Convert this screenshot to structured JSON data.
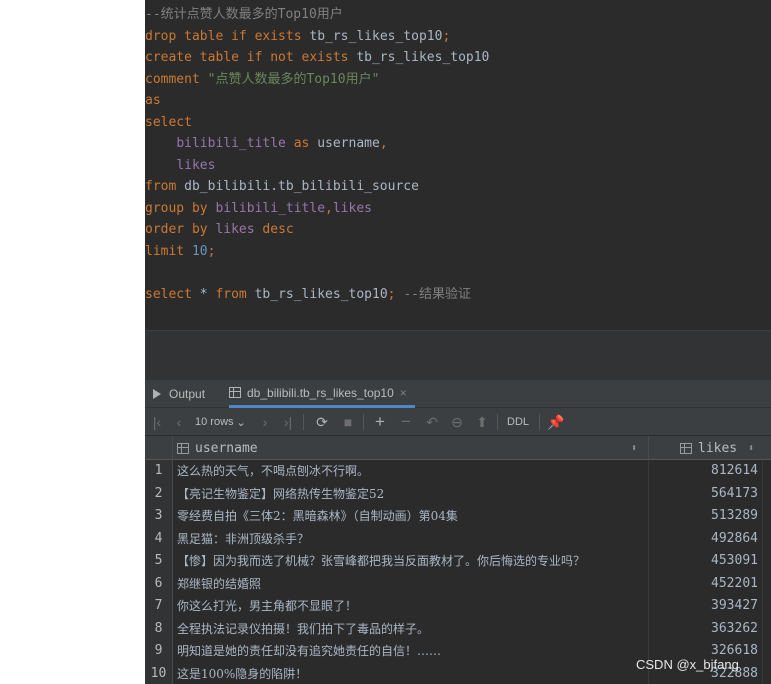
{
  "editor": {
    "lines": [
      [
        [
          "cmt",
          "--统计点赞人数最多的Top10用户"
        ]
      ],
      [
        [
          "kw",
          "drop table if exists "
        ],
        [
          "plain",
          "tb_rs_likes_top10"
        ],
        [
          "kw",
          ";"
        ]
      ],
      [
        [
          "kw",
          "create table if not exists "
        ],
        [
          "plain",
          "tb_rs_likes_top10"
        ]
      ],
      [
        [
          "kw",
          "comment "
        ],
        [
          "str",
          "\"点赞人数最多的Top10用户\""
        ]
      ],
      [
        [
          "kw",
          "as"
        ]
      ],
      [
        [
          "kw",
          "select"
        ]
      ],
      [
        [
          "plain",
          "    "
        ],
        [
          "fld",
          "bilibili_title"
        ],
        [
          "kw",
          " as "
        ],
        [
          "plain",
          "username"
        ],
        [
          "kw",
          ","
        ]
      ],
      [
        [
          "plain",
          "    "
        ],
        [
          "fld",
          "likes"
        ]
      ],
      [
        [
          "kw",
          "from "
        ],
        [
          "plain",
          "db_bilibili.tb_bilibili_source"
        ]
      ],
      [
        [
          "kw",
          "group by "
        ],
        [
          "fld",
          "bilibili_title"
        ],
        [
          "kw",
          ","
        ],
        [
          "fld",
          "likes"
        ]
      ],
      [
        [
          "kw",
          "order by "
        ],
        [
          "fld",
          "likes"
        ],
        [
          "kw",
          " desc"
        ]
      ],
      [
        [
          "kw",
          "limit "
        ],
        [
          "num",
          "10"
        ],
        [
          "kw",
          ";"
        ]
      ],
      [],
      [
        [
          "kw",
          "select "
        ],
        [
          "plain",
          "* "
        ],
        [
          "kw",
          "from "
        ],
        [
          "plain",
          "tb_rs_likes_top10"
        ],
        [
          "kw",
          "; "
        ],
        [
          "cmt",
          "--结果验证"
        ]
      ]
    ]
  },
  "tabs": {
    "output_label": "Output",
    "result_label": "db_bilibili.tb_rs_likes_top10",
    "close_glyph": "×"
  },
  "toolbar": {
    "rows_label": "10 rows",
    "rows_arrow": "⌄",
    "ddl_label": "DDL"
  },
  "table": {
    "columns": [
      "username",
      "likes"
    ],
    "sort_glyph": "⬍",
    "rows": [
      {
        "n": "1",
        "username": "这么热的天气，不喝点刨冰不行啊。",
        "likes": "812614"
      },
      {
        "n": "2",
        "username": "【亮记生物鉴定】网络热传生物鉴定52",
        "likes": "564173"
      },
      {
        "n": "3",
        "username": "零经费自拍《三体2：黑暗森林》（自制动画）第04集",
        "likes": "513289"
      },
      {
        "n": "4",
        "username": "黑足猫：非洲顶级杀手？",
        "likes": "492864"
      },
      {
        "n": "5",
        "username": "【惨】因为我而选了机械？张雪峰都把我当反面教材了。你后悔选的专业吗？",
        "likes": "453091"
      },
      {
        "n": "6",
        "username": "郑继银的结婚照",
        "likes": "452201"
      },
      {
        "n": "7",
        "username": "你这么打光，男主角都不显眼了！",
        "likes": "393427"
      },
      {
        "n": "8",
        "username": "全程执法记录仪拍摄！我们拍下了毒品的样子。",
        "likes": "363262"
      },
      {
        "n": "9",
        "username": "明知道是她的责任却没有追究她责任的自信！……",
        "likes": "326618"
      },
      {
        "n": "10",
        "username": "这是100%隐身的陷阱！",
        "likes": "322888"
      }
    ]
  },
  "watermark": "CSDN @x_bjfang"
}
